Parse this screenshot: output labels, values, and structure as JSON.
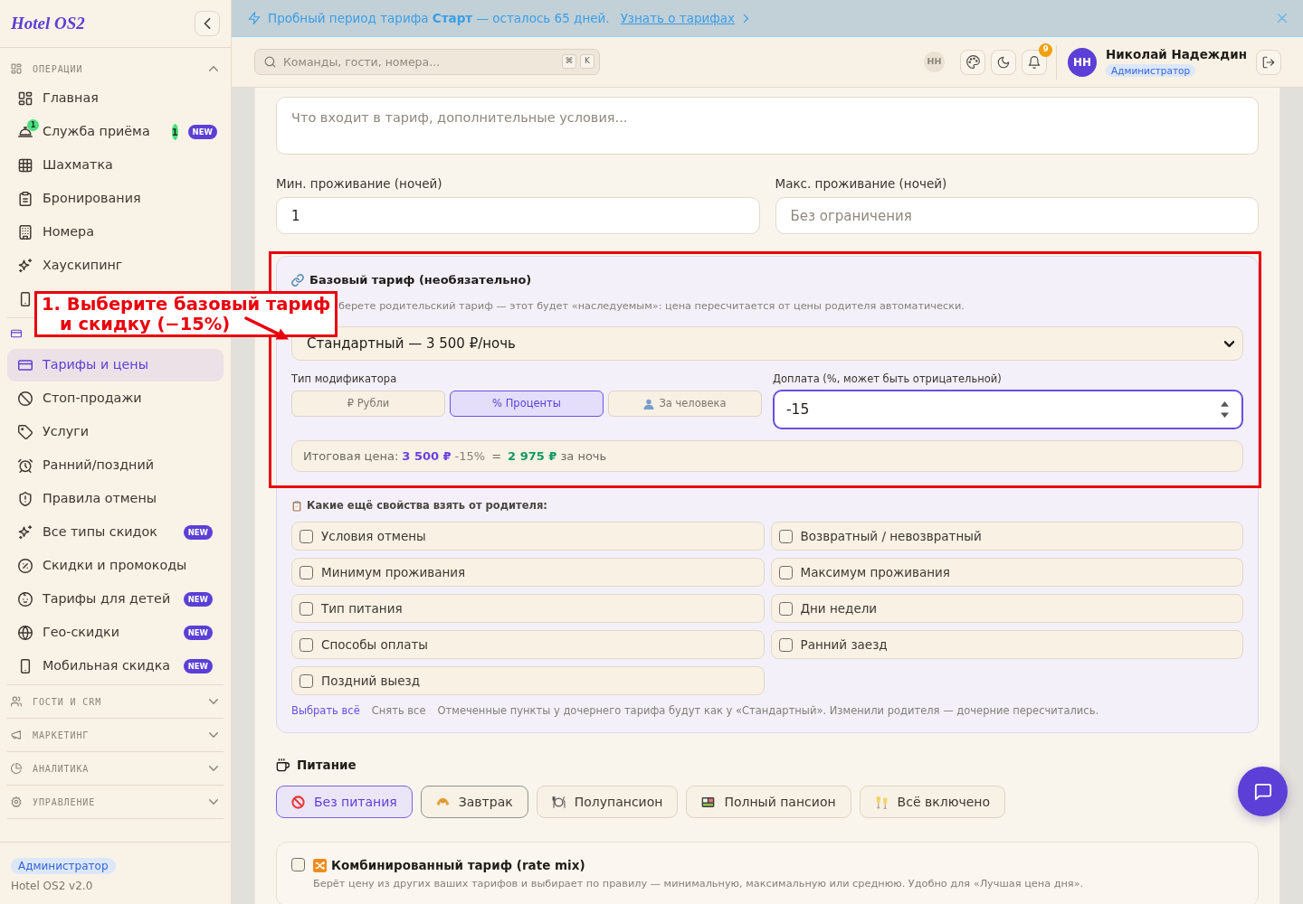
{
  "sidebar": {
    "logo": "Hotel OS2",
    "groups": [
      {
        "label": "ОПЕРАЦИИ",
        "expanded": true,
        "items": [
          {
            "label": "Главная",
            "selected": false
          },
          {
            "label": "Служба приёма",
            "selected": false,
            "icon_badge": "1",
            "count": "1",
            "tag": "NEW"
          },
          {
            "label": "Шахматка",
            "selected": false
          },
          {
            "label": "Бронирования",
            "selected": false
          },
          {
            "label": "Номера",
            "selected": false
          },
          {
            "label": "Хаускипинг",
            "selected": false
          },
          {
            "selected": false
          }
        ]
      },
      {
        "items": [
          {
            "label": "Тарифы и цены",
            "selected": true
          },
          {
            "label": "Стоп-продажи",
            "selected": false
          },
          {
            "label": "Услуги",
            "selected": false
          },
          {
            "label": "Ранний/поздний",
            "selected": false
          },
          {
            "label": "Правила отмены",
            "selected": false
          },
          {
            "label": "Все типы скидок",
            "selected": false,
            "tag": "NEW"
          },
          {
            "label": "Скидки и промокоды",
            "selected": false
          },
          {
            "label": "Тарифы для детей",
            "selected": false,
            "tag": "NEW"
          },
          {
            "label": "Гео-скидки",
            "selected": false,
            "tag": "NEW"
          },
          {
            "label": "Мобильная скидка",
            "selected": false,
            "tag": "NEW"
          }
        ]
      },
      {
        "label": "ГОСТИ И CRM",
        "expanded": false
      },
      {
        "label": "МАРКЕТИНГ",
        "expanded": false
      },
      {
        "label": "АНАЛИТИКА",
        "expanded": false
      },
      {
        "label": "УПРАВЛЕНИЕ",
        "expanded": false
      }
    ],
    "footer": {
      "role": "Администратор",
      "version": "Hotel OS2 v2.0"
    }
  },
  "banner": {
    "text": "Пробный период тарифа **Старт** — осталось 65 дней.",
    "link": "Узнать о тарифах"
  },
  "topbar": {
    "search": {
      "placeholder": "Команды, гости, номера...",
      "keys": [
        "⌘",
        "K"
      ]
    },
    "presence": "НН",
    "notifications": "9",
    "user": {
      "initials": "НН",
      "name": "Николай Надеждин",
      "role": "Администратор"
    }
  },
  "form": {
    "notes": {
      "placeholder": "Что входит в тариф, дополнительные условия..."
    },
    "stay_limits": [
      {
        "label": "Мин. проживание (ночей)",
        "value": "1"
      },
      {
        "label": "Макс. проживание (ночей)",
        "placeholder": "Без ограничения"
      }
    ],
    "base_rate": {
      "title": "Базовый тариф (необязательно)",
      "description": "берете родительский тариф — этот будет «наследуемым»: цена пересчитается от цены родителя автоматически.",
      "parent": "Стандартный — 3 500 ₽/ночь",
      "modifier_type": {
        "label": "Тип модификатора",
        "options": [
          {
            "label": "₽ Рубли",
            "selected": false
          },
          {
            "label": "% Проценты",
            "selected": true
          },
          {
            "label": "За человека",
            "selected": false
          }
        ]
      },
      "surcharge": {
        "label": "Доплата (%, может быть отрицательной)",
        "value": "-15",
        "focused": true
      },
      "result": {
        "label": "Итоговая цена:",
        "base_price": "3 500 ₽",
        "modifier": "-15%",
        "operator": "=",
        "total": "2 975 ₽",
        "suffix": "за ночь"
      },
      "inherit": {
        "title": "Какие ещё свойства взять от родителя:",
        "options": [
          {
            "label": "Условия отмены",
            "checked": false
          },
          {
            "label": "Возвратный / невозвратный",
            "checked": false
          },
          {
            "label": "Минимум проживания",
            "checked": false
          },
          {
            "label": "Максимум проживания",
            "checked": false
          },
          {
            "label": "Тип питания",
            "checked": false
          },
          {
            "label": "Дни недели",
            "checked": false
          },
          {
            "label": "Способы оплаты",
            "checked": false
          },
          {
            "label": "Ранний заезд",
            "checked": false
          },
          {
            "label": "Поздний выезд",
            "checked": false
          }
        ],
        "select_all": "Выбрать всё",
        "clear_all": "Снять все",
        "hint": "Отмеченные пункты у дочернего тарифа будут как у «Стандартный». Изменили родителя — дочерние пересчитались."
      }
    },
    "meals": {
      "title": "Питание",
      "options": [
        {
          "label": "Без питания",
          "selected": true,
          "focused": false
        },
        {
          "label": "Завтрак",
          "selected": false,
          "focused": true
        },
        {
          "label": "Полупансион",
          "selected": false,
          "focused": false
        },
        {
          "label": "Полный пансион",
          "selected": false,
          "focused": false
        },
        {
          "label": "Всё включено",
          "selected": false,
          "focused": false
        }
      ]
    },
    "rate_mix": {
      "checked": false,
      "title": "Комбинированный тариф (rate mix)",
      "description": "Берёт цену из других ваших тарифов и выбирает по правилу — минимальную, максимальную или среднюю. Удобно для «Лучшая цена дня»."
    }
  },
  "annotation": {
    "lines": [
      "1. Выберите базовый тариф",
      "и скидку (−15%)"
    ]
  }
}
